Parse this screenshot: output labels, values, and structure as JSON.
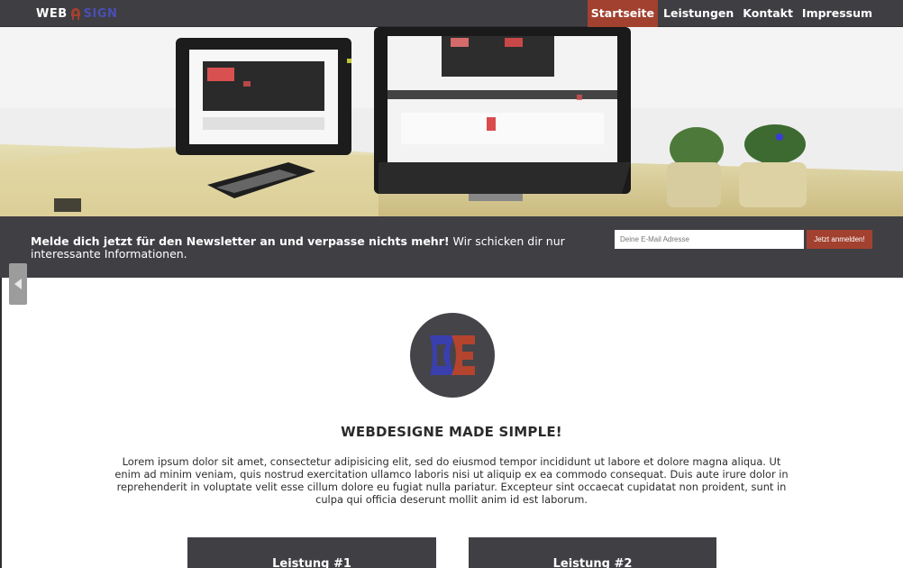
{
  "header": {
    "logo_left": "WEB",
    "logo_right": "SIGN",
    "nav": [
      {
        "label": "Startseite",
        "active": true
      },
      {
        "label": "Leistungen",
        "active": false
      },
      {
        "label": "Kontakt",
        "active": false
      },
      {
        "label": "Impressum",
        "active": false
      }
    ]
  },
  "newsletter": {
    "bold_text": "Melde dich jetzt für den Newsletter an und verpasse nichts mehr!",
    "text": " Wir schicken dir nur interessante Informationen.",
    "input_placeholder": "Deine E-Mail Adresse",
    "button_label": "Jetzt anmelden!"
  },
  "content": {
    "headline": "WEBDESIGNE MADE SIMPLE!",
    "lorem": "Lorem ipsum dolor sit amet, consectetur adipisicing elit, sed do eiusmod tempor incididunt ut labore et dolore magna aliqua. Ut enim ad minim veniam, quis nostrud exercitation ullamco laboris nisi ut aliquip ex ea commodo consequat. Duis aute irure dolor in reprehenderit in voluptate velit esse cillum dolore eu fugiat nulla pariatur. Excepteur sint occaecat cupidatat non proident, sunt in culpa qui officia deserunt mollit anim id est laborum.",
    "cards": [
      {
        "title": "Leistung #1"
      },
      {
        "title": "Leistung #2"
      }
    ]
  },
  "colors": {
    "nav_bg": "#3f3e43",
    "accent": "#a2412f",
    "logo_blue": "#4a4fb3",
    "dark_panel": "#403f44"
  },
  "icons": {
    "logo_mark": "helmet-icon",
    "side_tab": "chevron-left-icon",
    "avatar": "de-logo-icon"
  }
}
